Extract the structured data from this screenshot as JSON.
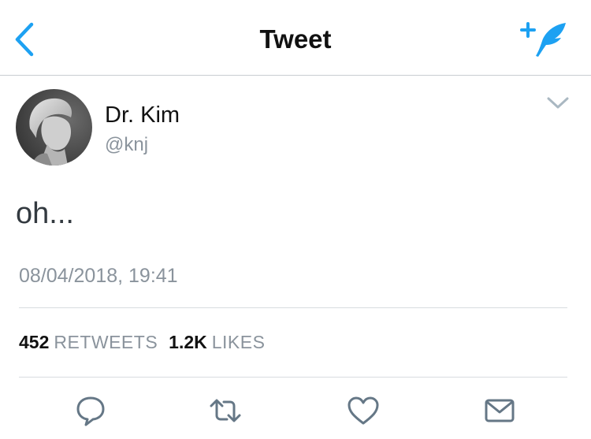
{
  "header": {
    "title": "Tweet",
    "back_icon": "chevron-left-icon",
    "compose_icon": "compose-feather-icon",
    "accent_color": "#1da1f2"
  },
  "tweet": {
    "author": {
      "display_name": "Dr. Kim",
      "handle": "@knj",
      "avatar": "profile-photo"
    },
    "text": "oh...",
    "timestamp": "08/04/2018, 19:41",
    "menu_icon": "chevron-down-icon"
  },
  "stats": {
    "retweets": {
      "count": "452",
      "label": "RETWEETS"
    },
    "likes": {
      "count": "1.2K",
      "label": "LIKES"
    }
  },
  "actions": [
    {
      "name": "reply",
      "icon": "reply-icon"
    },
    {
      "name": "retweet",
      "icon": "retweet-icon"
    },
    {
      "name": "like",
      "icon": "heart-icon"
    },
    {
      "name": "message",
      "icon": "envelope-icon"
    }
  ],
  "colors": {
    "text_primary": "#14171a",
    "text_secondary": "#8a939c",
    "divider": "#d8dce0",
    "icon_gray": "#657786"
  }
}
